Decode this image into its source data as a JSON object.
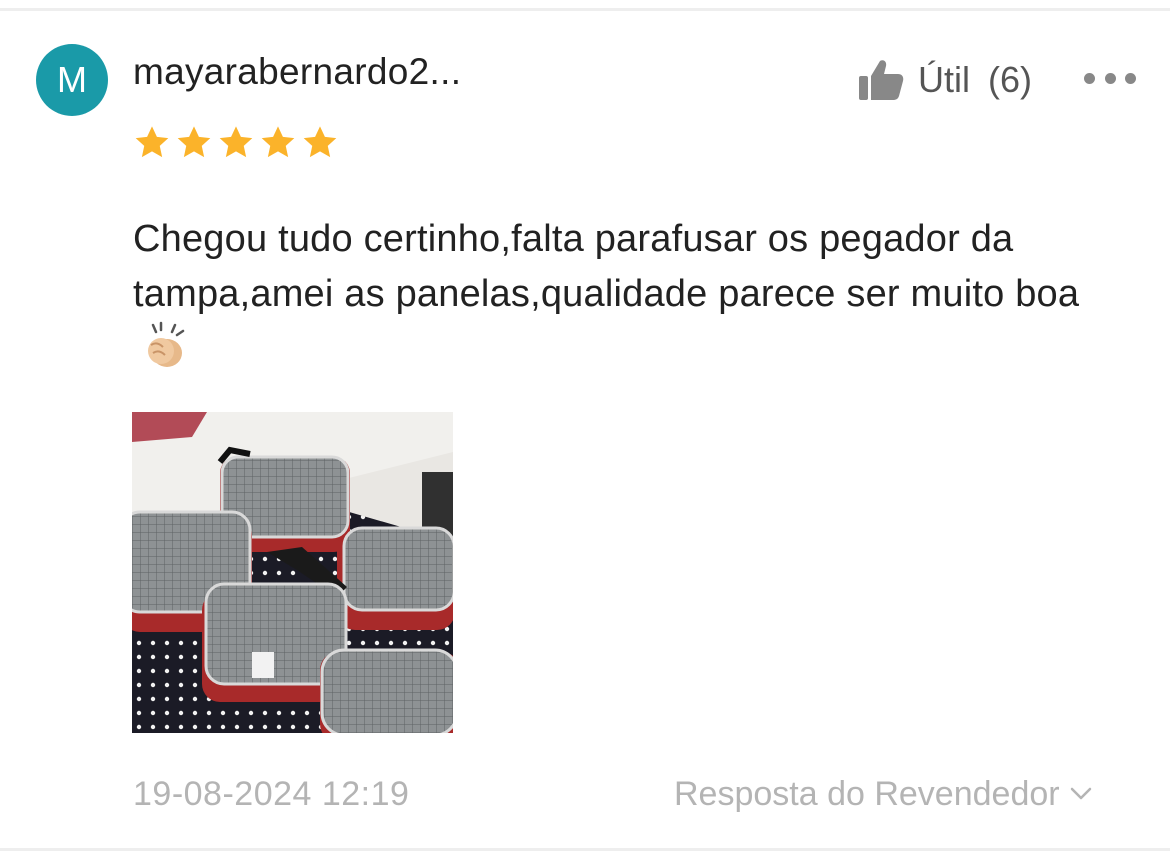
{
  "review": {
    "avatar_initial": "M",
    "username": "mayarabernardo2...",
    "helpful_label": "Útil",
    "helpful_count": "(6)",
    "rating": 5,
    "text": "Chegou tudo certinho,falta parafusar os pegador da tampa,amei as panelas,qualidade parece ser muito boa",
    "emoji": "clapping-hands",
    "timestamp": "19-08-2024 12:19",
    "seller_reply_label": "Resposta do Revendedor"
  },
  "icons": {
    "helpful": "thumbs-up-icon",
    "more": "more-options-icon",
    "star": "star-icon",
    "expand": "chevron-down-icon"
  },
  "colors": {
    "avatar_bg": "#1a9aa8",
    "star": "#fbb32a",
    "muted_text": "#b4b4b4",
    "icon_gray": "#888888"
  }
}
